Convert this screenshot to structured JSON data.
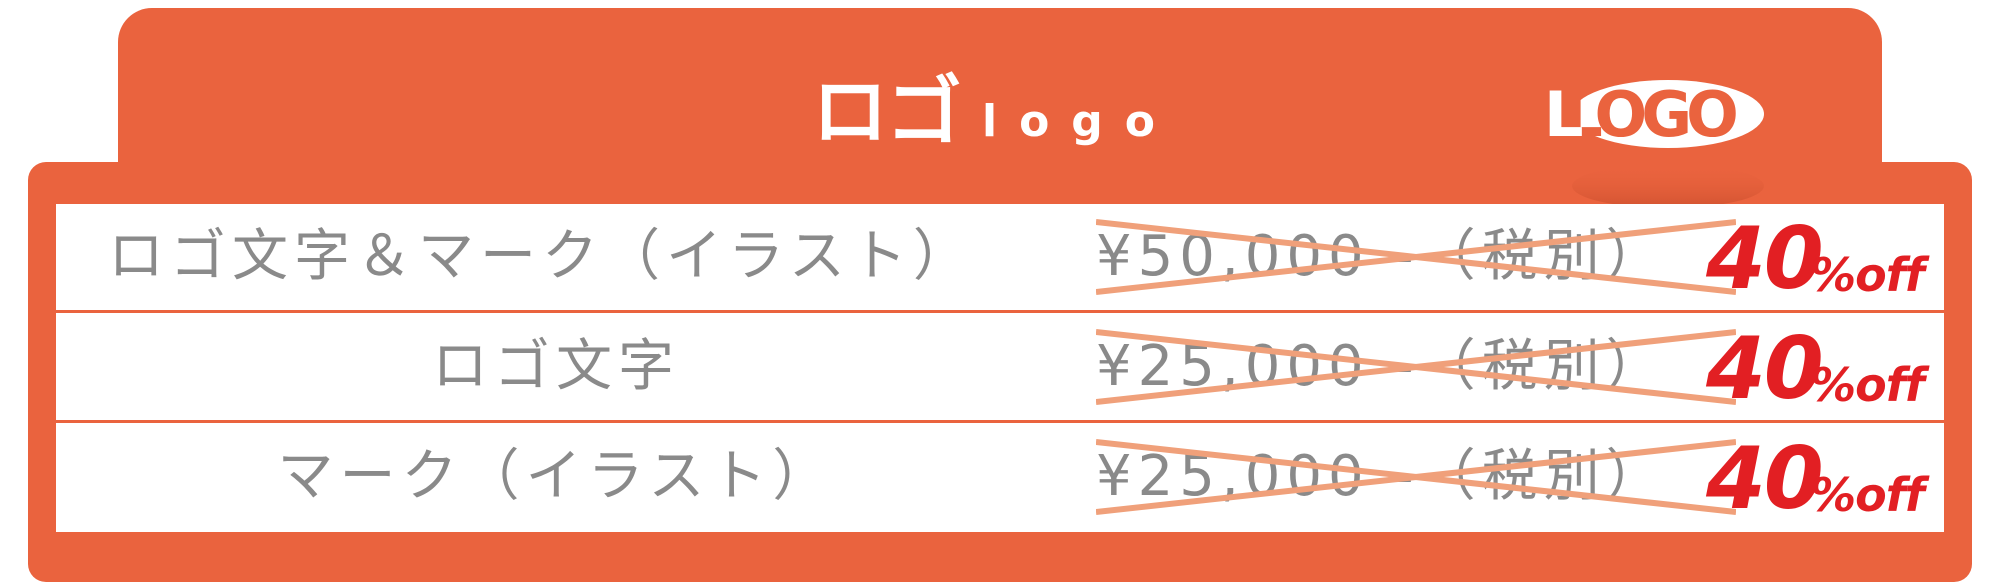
{
  "header": {
    "title_jp": "ロゴ",
    "title_en": "logo",
    "logo_text": "LOGO"
  },
  "rows": [
    {
      "label": "ロゴ文字＆マーク（イラスト）",
      "price": "¥50,000 -（税別）",
      "discount_value": "40",
      "discount_suffix": "%off"
    },
    {
      "label": "ロゴ文字",
      "price": "¥25,000 -（税別）",
      "discount_value": "40",
      "discount_suffix": "%off"
    },
    {
      "label": "マーク（イラスト）",
      "price": "¥25,000 -（税別）",
      "discount_value": "40",
      "discount_suffix": "%off"
    }
  ],
  "colors": {
    "accent": "#ea633e",
    "text_gray": "#8a8a8a",
    "discount_red": "#e21f23",
    "strike": "#f0a07a"
  }
}
